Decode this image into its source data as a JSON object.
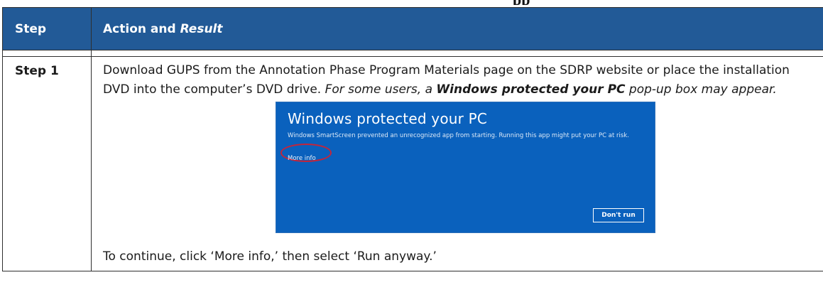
{
  "page": {
    "top_title": "pp"
  },
  "table": {
    "headers": {
      "step": "Step",
      "action_prefix": "Action and ",
      "action_italic": "Result"
    },
    "rows": [
      {
        "step": "Step 1",
        "text_1": "Download GUPS from the Annotation Phase Program Materials page on the SDRP website or place the installation DVD into the computer’s DVD drive. ",
        "text_2": "For some users, a ",
        "text_3": "Windows protected your PC",
        "text_4": " pop-up box may appear.",
        "final_text": "To continue, click ‘More info,’ then select ‘Run anyway.’"
      }
    ]
  },
  "dialog": {
    "title": "Windows protected your PC",
    "message": "Windows SmartScreen prevented an unrecognized app from starting. Running this app might put your PC at risk.",
    "more_info": "More info",
    "dont_run": "Don't run",
    "bg_color": "#0a61bd",
    "highlight_color": "#c4253a"
  }
}
